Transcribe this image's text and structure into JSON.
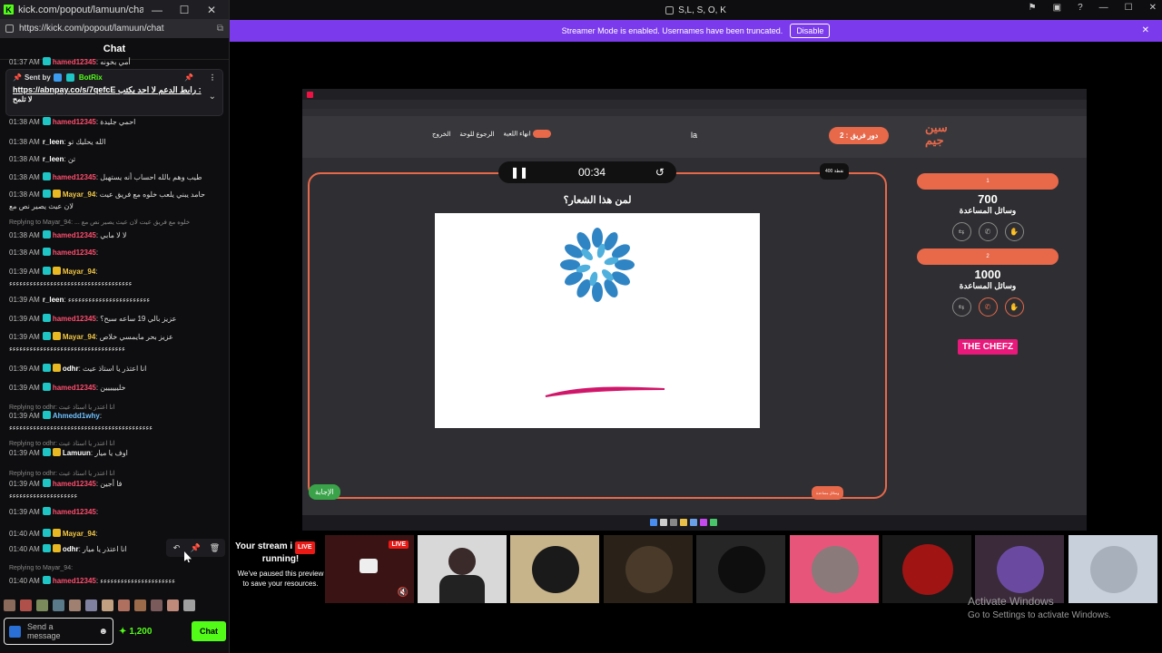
{
  "popout": {
    "window_title": "kick.com/popout/lamuun/chat - ...",
    "url": "https://kick.com/popout/lamuun/chat",
    "header": "Chat",
    "pinned": {
      "sent_by_prefix": "Sent by",
      "bot_name": "BotRix",
      "text_line1": "رابط الدعم لا احد يكتب :",
      "link": "https://abnpay.co/s/7qefcE",
      "text_line2": "لا تلمح"
    },
    "messages": [
      {
        "time": "01:37 AM",
        "user": "hamed12345",
        "text": "أمي بخونه"
      },
      {
        "time": "01:38 AM",
        "user": "hamed12345",
        "text": "احمي جليدة"
      },
      {
        "time": "01:38 AM",
        "user": "r_leen",
        "text": "الله يحليك تو"
      },
      {
        "time": "01:38 AM",
        "user": "r_leen",
        "text": "تن"
      },
      {
        "time": "01:38 AM",
        "user": "hamed12345",
        "text": "طيب وهم بالله احساب أنه يستهبل"
      },
      {
        "time": "01:38 AM",
        "user": "Mayar_94",
        "text": "حامد يبني يلعب خلوه مع فريق عيت",
        "text2": "لان عيث يصير نص مع"
      },
      {
        "reply": "Replying to Mayar_94: ... خلوه مع فريق عيت لان عيث يصير نص مع"
      },
      {
        "time": "01:38 AM",
        "user": "hamed12345",
        "text": "لا لا مابي"
      },
      {
        "time": "01:38 AM",
        "user": "hamed12345",
        "text": ""
      },
      {
        "time": "01:39 AM",
        "user": "Mayar_94",
        "text": "",
        "text2": "ءءءءءءءءءءءءءءءءءءءءءءءءءءءءءءءءءءءء"
      },
      {
        "time": "01:39 AM",
        "user": "r_leen",
        "text": "ءءءءءءءءءءءءءءءءءءءءءءءء"
      },
      {
        "time": "01:39 AM",
        "user": "hamed12345",
        "text": "عزيز بالي 19 ساعه سبح؟"
      },
      {
        "time": "01:39 AM",
        "user": "Mayar_94",
        "text": "عزيز بحر مايمسي خلاص",
        "text2": "ءءءءءءءءءءءءءءءءءءءءءءءءءءءءءءءءءء"
      },
      {
        "time": "01:39 AM",
        "user": "odhr",
        "text": "انا اعتذر يا استاذ عيث"
      },
      {
        "time": "01:39 AM",
        "user": "hamed12345",
        "text": "خليييييين"
      },
      {
        "reply": "Replying to odhr: انا اعتذر يا استاذ عيث"
      },
      {
        "time": "01:39 AM",
        "user": "Ahmedd1why",
        "text": "",
        "text2": "ءءءءءءءءءءءءءءءءءءءءءءءءءءءءءءءءءءءءءءءءءء"
      },
      {
        "reply": "Replying to odhr: انا اعتذر يا استاذ عيث"
      },
      {
        "time": "01:39 AM",
        "user": "Lamuun",
        "text": "اوف يا ميار"
      },
      {
        "reply": "Replying to odhr: انا اعتذر يا استاذ عيث"
      },
      {
        "time": "01:39 AM",
        "user": "hamed12345",
        "text": "فا أجين",
        "text2": "ءءءءءءءءءءءءءءءءءءءء"
      },
      {
        "time": "01:39 AM",
        "user": "hamed12345",
        "text": ""
      },
      {
        "time": "01:40 AM",
        "user": "Mayar_94",
        "text": ""
      },
      {
        "time": "01:40 AM",
        "user": "odhr",
        "text": "انا اعتذر يا ميار"
      },
      {
        "reply": "Replying to Mayar_94:"
      },
      {
        "time": "01:40 AM",
        "user": "hamed12345",
        "text": "ءءءءءءءءءءءءءءءءءءءءءء"
      }
    ],
    "send_placeholder": "Send a message",
    "points": "1,200",
    "chat_button": "Chat"
  },
  "browser": {
    "tab_title": "S,L, S, O, K",
    "banner_text": "Streamer Mode is enabled. Usernames have been truncated.",
    "banner_button": "Disable"
  },
  "game": {
    "top_buttons": [
      "انهاء اللعبة",
      "الرجوع للوحة",
      "الخروج"
    ],
    "center_text": "la",
    "turn_label": "دور فريق : 2",
    "logo_text": "سين جيم",
    "timer": "00:34",
    "points_badge": "400 نقطة",
    "question": "لمن هذا الشعار؟",
    "answer_button": "الإجابة",
    "help_button": "وسائل مساعدة",
    "teams": [
      {
        "name": "1",
        "score": "700",
        "help_label": "وسائل المساعدة"
      },
      {
        "name": "2",
        "score": "1000",
        "help_label": "وسائل المساعدة"
      }
    ],
    "sponsor": "THE CHEFZ"
  },
  "paused": {
    "title_line1": "Your stream i",
    "title_line2": "running!",
    "live": "LIVE",
    "message": "We've paused this preview to save your resources."
  },
  "activate": {
    "line1": "Activate Windows",
    "line2": "Go to Settings to activate Windows."
  },
  "colors": {
    "kick_green": "#53fc18",
    "streamer_banner": "#7c3aed",
    "game_accent": "#e8684a",
    "live_red": "#e91916"
  }
}
